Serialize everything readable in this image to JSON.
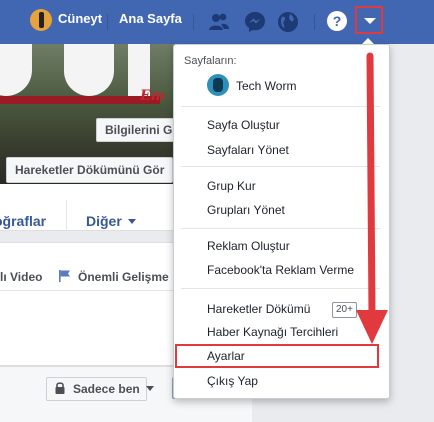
{
  "topbar": {
    "username": "Cüneyt",
    "home_label": "Ana Sayfa",
    "icons": [
      "friends-icon",
      "messenger-icon",
      "globe-icon",
      "help-icon",
      "dropdown-arrow-icon"
    ],
    "help_glyph": "?"
  },
  "cover": {
    "script_text": "Em",
    "info_button": "Bilgilerini Gü",
    "activity_log_button": "Hareketler Dökümünü Gör"
  },
  "tabs": {
    "photos": "oğraflar",
    "more": "Diğer"
  },
  "composer": {
    "live_video": "lı Video",
    "life_event": "Önemli Gelişme",
    "privacy": "Sadece ben"
  },
  "menu": {
    "pages_header": "Sayfaların:",
    "page_name": "Tech Worm",
    "items": {
      "create_page": "Sayfa Oluştur",
      "manage_pages": "Sayfaları Yönet",
      "create_group": "Grup Kur",
      "manage_groups": "Grupları Yönet",
      "create_ad": "Reklam Oluştur",
      "advertise": "Facebook'ta Reklam Verme",
      "activity_log": "Hareketler Dökümü",
      "activity_badge": "20+",
      "news_feed_prefs": "Haber Kaynağı Tercihleri",
      "settings": "Ayarlar",
      "logout": "Çıkış Yap"
    }
  },
  "colors": {
    "topbar": "#4267b2",
    "highlight": "#e0393e",
    "link": "#365899"
  }
}
